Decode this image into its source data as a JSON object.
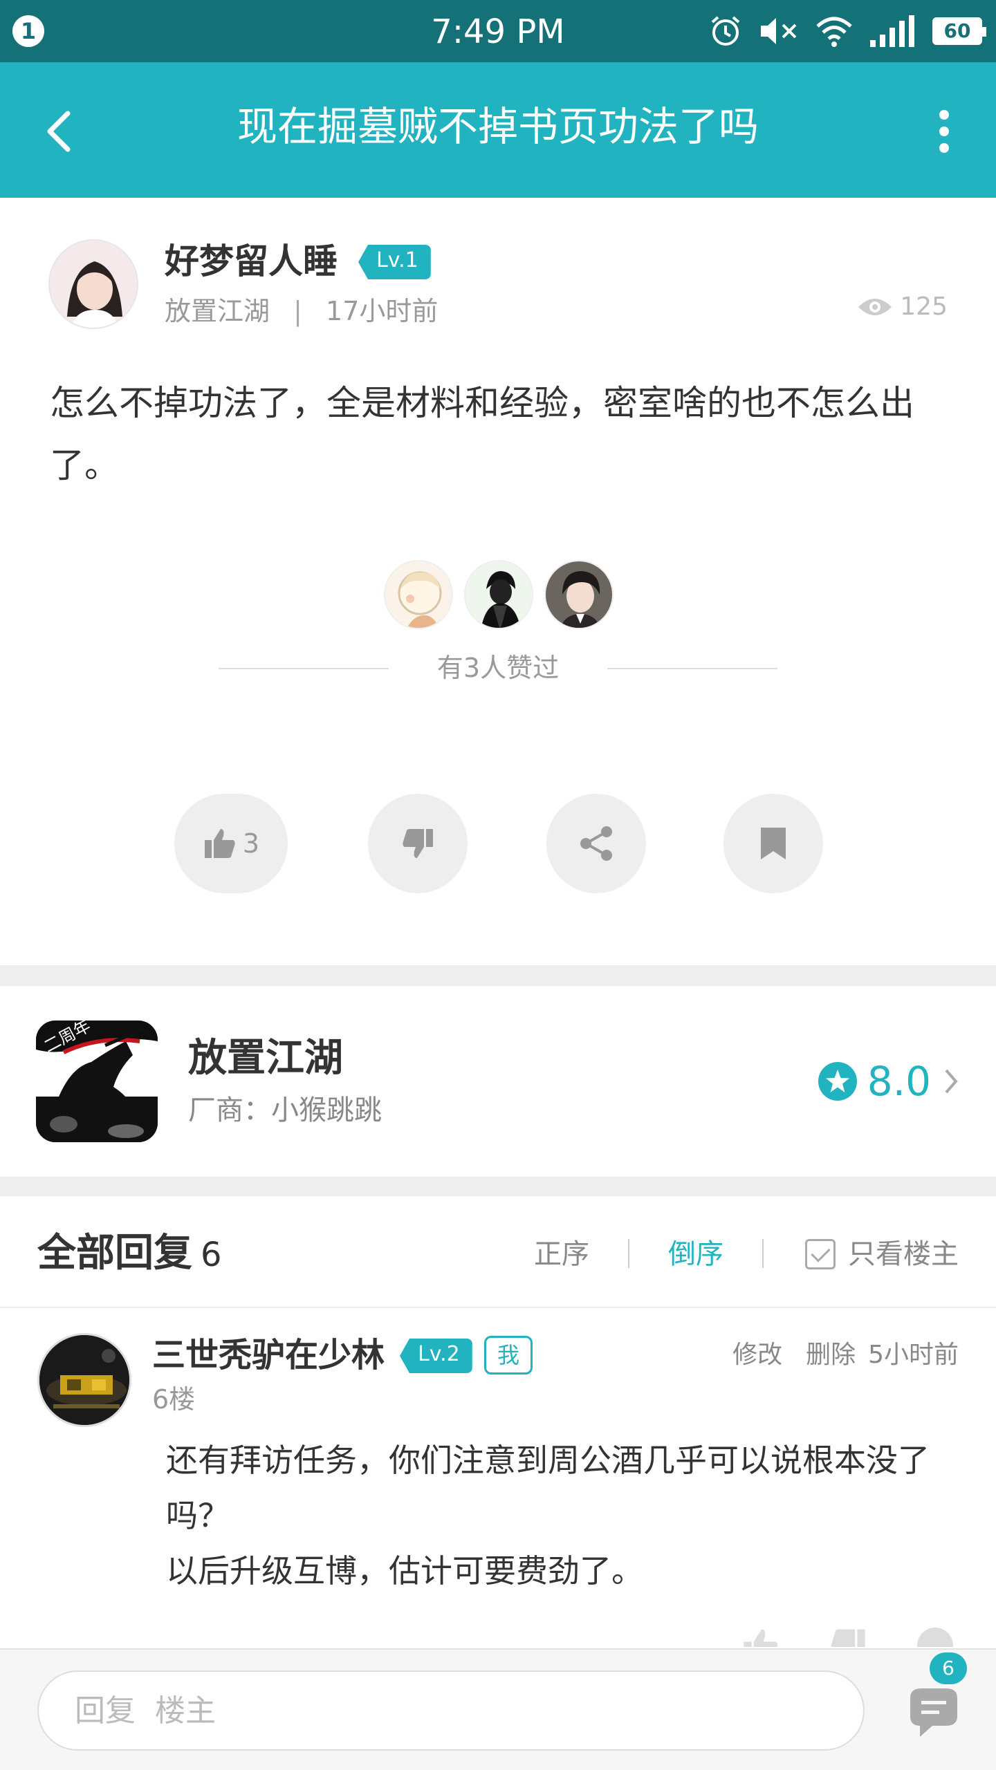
{
  "status_bar": {
    "notification_count": "1",
    "time": "7:49 PM",
    "battery": "60",
    "icons": [
      "alarm-icon",
      "mute-icon",
      "wifi-icon",
      "signal-icon",
      "battery-icon"
    ]
  },
  "header": {
    "title": "现在掘墓贼不掉书页功法了吗",
    "back_icon": "back-arrow-icon",
    "more_icon": "more-vertical-icon",
    "background": "#22b3c0"
  },
  "post": {
    "author": "好梦留人睡",
    "level": "Lv.1",
    "forum": "放置江湖",
    "separator": "|",
    "time": "17小时前",
    "views": "125",
    "content": "怎么不掉功法了，全是材料和经验，密室啥的也不怎么出了。",
    "likes_text": "有3人赞过",
    "like_count": "3",
    "actions": [
      "like-icon",
      "dislike-icon",
      "share-icon",
      "bookmark-icon"
    ]
  },
  "game": {
    "name": "放置江湖",
    "vendor": "厂商：小猴跳跳",
    "rating": "8.0",
    "icon_text": "二周年"
  },
  "replies": {
    "title": "全部回复",
    "count": "6",
    "sort_asc": "正序",
    "sort_desc": "倒序",
    "owner_only": "只看楼主",
    "items": [
      {
        "author": "三世秃驴在少林",
        "level": "Lv.2",
        "me_badge": "我",
        "edit": "修改",
        "delete": "删除",
        "time": "5小时前",
        "floor": "6楼",
        "content_line1": "还有拜访任务，你们注意到周公酒几乎可以说根本没了吗？",
        "content_line2": "以后升级互博，估计可要费劲了。"
      }
    ]
  },
  "bottom_bar": {
    "placeholder": "回复  楼主",
    "comment_badge": "6"
  },
  "colors": {
    "accent": "#22b3c0",
    "status_bar": "#147178",
    "text": "#333333",
    "muted": "#999999"
  }
}
